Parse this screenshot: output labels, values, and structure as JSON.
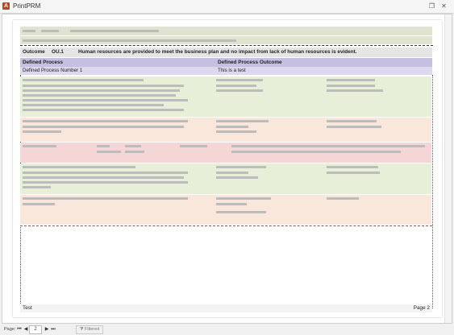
{
  "window": {
    "title": "PrintPRM",
    "app_icon": "A",
    "restore_glyph": "❐",
    "close_glyph": "✕"
  },
  "report": {
    "outcome_label": "Outcome",
    "outcome_code": "OU.1",
    "outcome_text": "Human resources are provided to meet the business plan and no impact from lack of human resources is evident.",
    "defined_process_label": "Defined Process",
    "defined_process_outcome_label": "Defined Process Outcome",
    "defined_process_number": "Defined Process Number 1",
    "defined_process_outcome_value": "This is a test"
  },
  "footer": {
    "left": "Test",
    "right": "Page 2"
  },
  "status": {
    "page_label": "Page:",
    "first_glyph": "⏮",
    "prev_glyph": "◀",
    "page_number": "2",
    "next_glyph": "▶",
    "last_glyph": "⏭",
    "filtered_label": "Filtered",
    "filter_icon_glyph": "⧩"
  },
  "colors": {
    "outcome_bg": "#e5e5e5",
    "defined_header_bg": "#c6bfe0",
    "green_section": "#e7efd9",
    "peach_section": "#f9e7dc",
    "pink_section": "#f5d6d6"
  }
}
